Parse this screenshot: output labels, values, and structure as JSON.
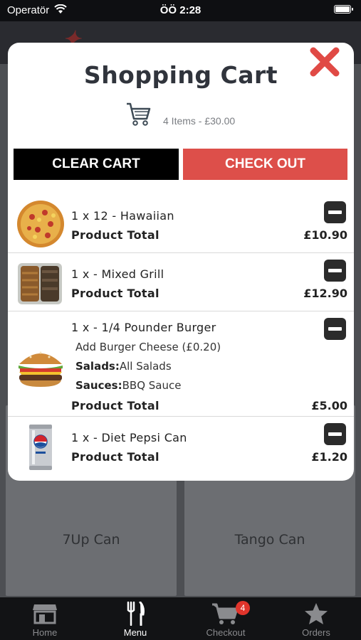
{
  "status_bar": {
    "carrier": "Operatör",
    "time": "ÖÖ 2:28"
  },
  "background": {
    "products": [
      {
        "label": "7Up Can"
      },
      {
        "label": "Tango Can"
      }
    ]
  },
  "modal": {
    "title": "Shopping Cart",
    "summary": "4 Items - £30.00",
    "clear_label": "CLEAR CART",
    "checkout_label": "CHECK OUT",
    "items": [
      {
        "name": "1 x 12 - Hawaiian",
        "total_label": "Product Total",
        "price": "£10.90",
        "image": "pizza-image"
      },
      {
        "name": "1 x - Mixed Grill",
        "total_label": "Product Total",
        "price": "£12.90",
        "image": "mixed-grill-image"
      },
      {
        "name": "1 x - 1/4 Pounder Burger",
        "options": {
          "addon": "Add Burger Cheese (£0.20)",
          "salads_label": "Salads:",
          "salads_value": "All Salads",
          "sauces_label": "Sauces:",
          "sauces_value": "BBQ Sauce"
        },
        "total_label": "Product Total",
        "price": "£5.00",
        "image": "burger-image"
      },
      {
        "name": "1 x - Diet Pepsi Can",
        "total_label": "Product Total",
        "price": "£1.20",
        "image": "pepsi-can-image"
      }
    ]
  },
  "tabbar": {
    "tabs": [
      {
        "label": "Home",
        "icon": "store-icon"
      },
      {
        "label": "Menu",
        "icon": "fork-knife-icon",
        "active": true
      },
      {
        "label": "Checkout",
        "icon": "cart-icon",
        "badge": "4"
      },
      {
        "label": "Orders",
        "icon": "star-icon"
      }
    ]
  },
  "colors": {
    "checkout_red": "#dd4f4a",
    "close_red": "#e04a45",
    "badge_red": "#e0342b"
  }
}
